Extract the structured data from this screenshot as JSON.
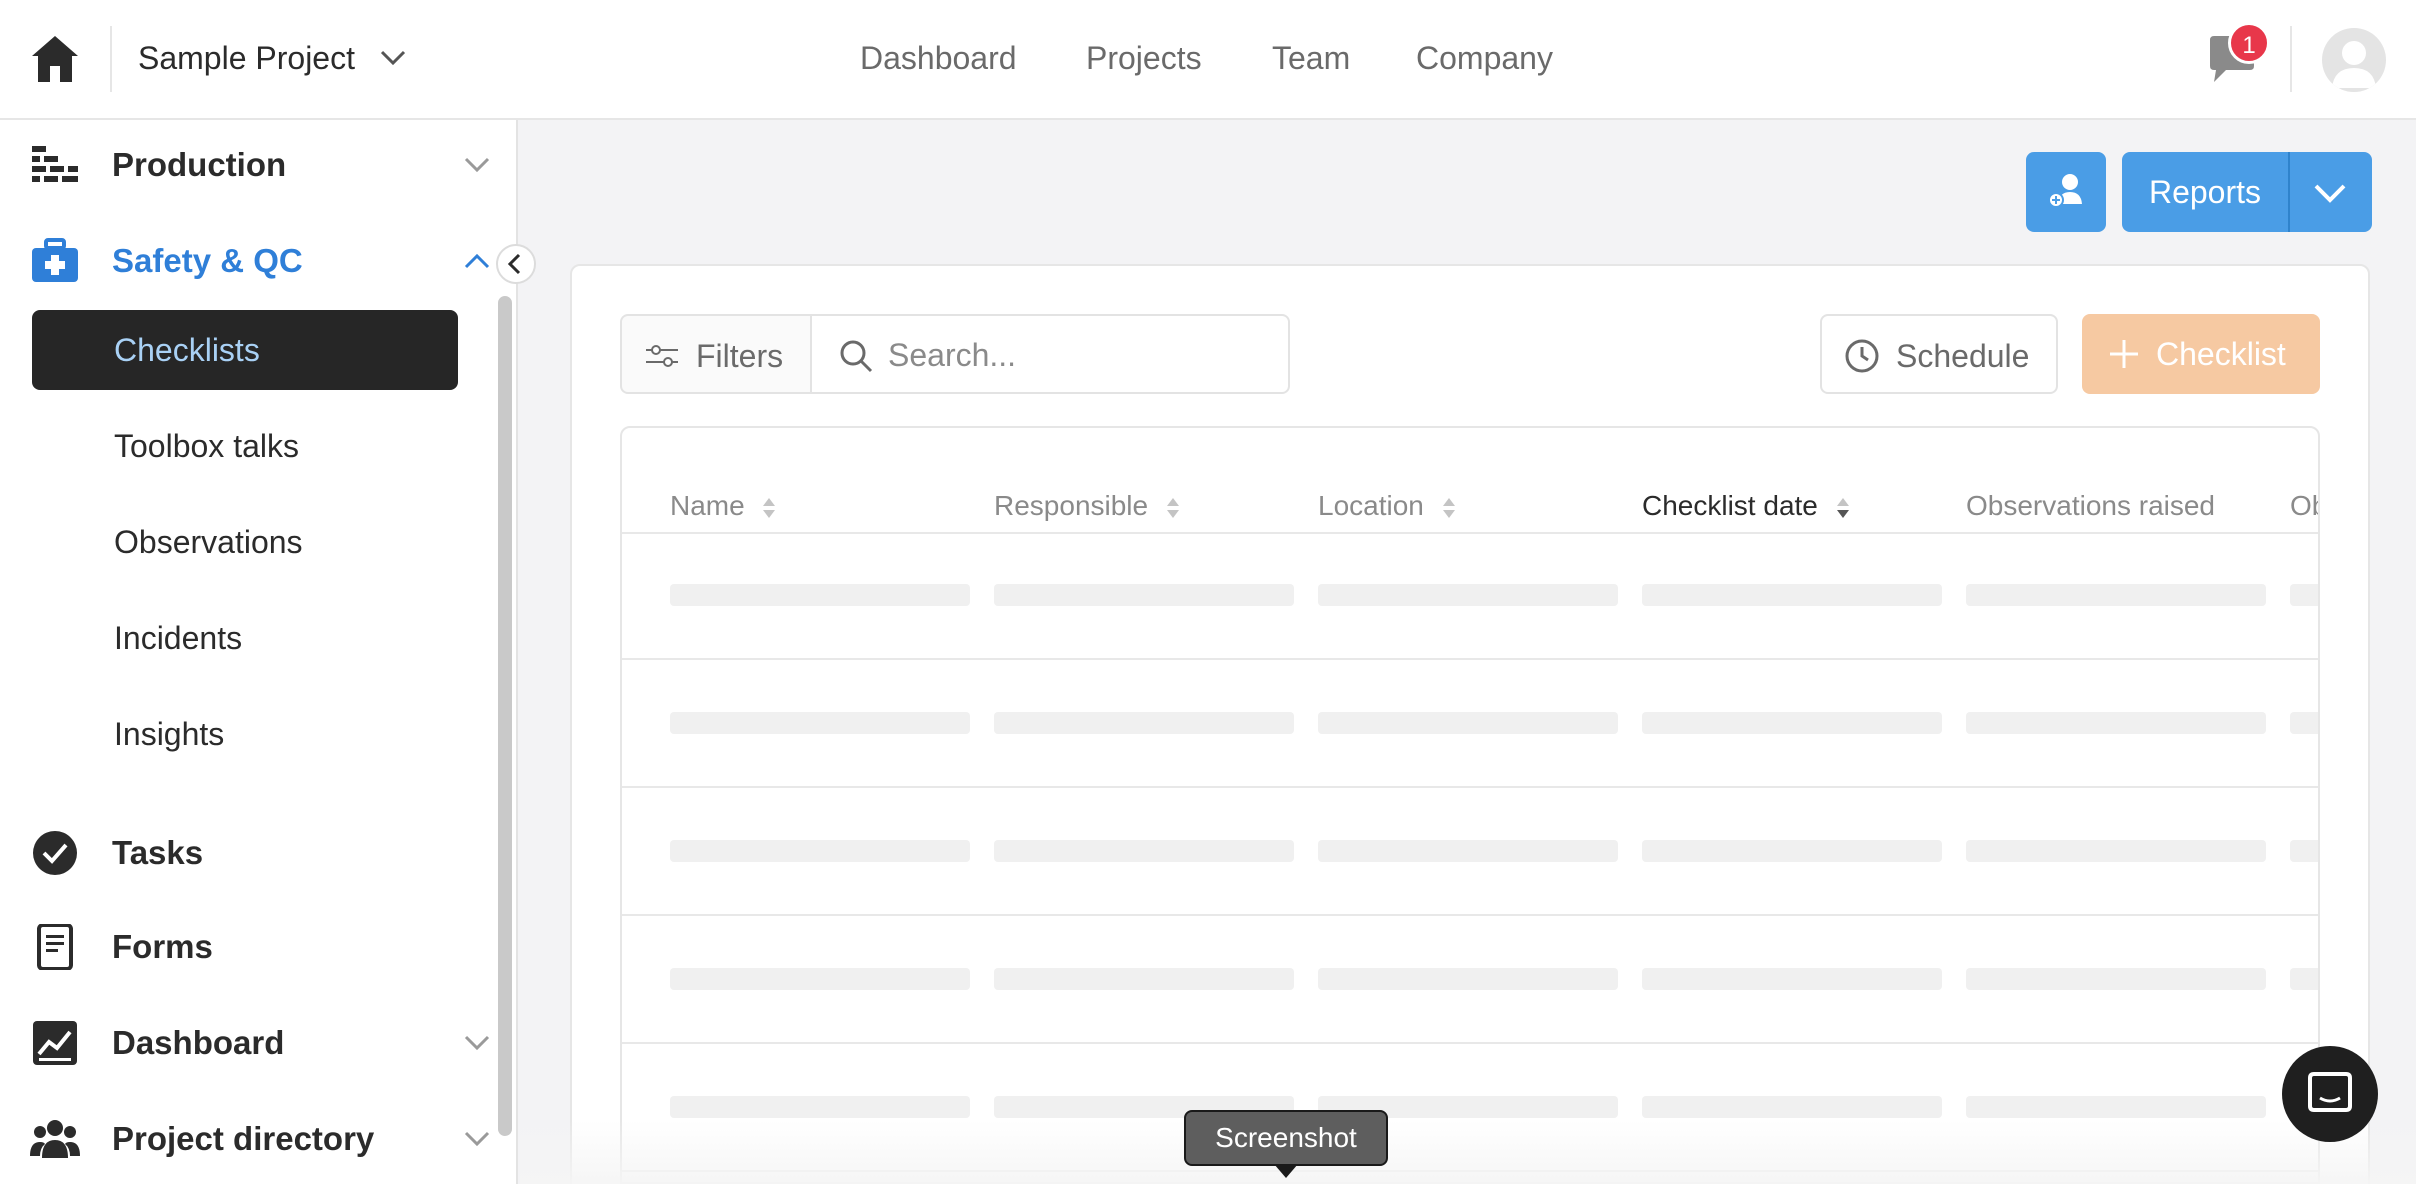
{
  "header": {
    "project_name": "Sample Project",
    "nav": [
      "Dashboard",
      "Projects",
      "Team",
      "Company"
    ],
    "notification_count": "1"
  },
  "sidebar": {
    "production": "Production",
    "safety": "Safety & QC",
    "safety_items": [
      "Checklists",
      "Toolbox talks",
      "Observations",
      "Incidents",
      "Insights"
    ],
    "active_item": "Checklists",
    "tasks": "Tasks",
    "forms": "Forms",
    "dashboard": "Dashboard",
    "project_directory": "Project directory"
  },
  "toolbar": {
    "reports_label": "Reports",
    "filters_label": "Filters",
    "search_placeholder": "Search...",
    "schedule_label": "Schedule",
    "checklist_label": "Checklist"
  },
  "table": {
    "columns": [
      "Name",
      "Responsible",
      "Location",
      "Checklist date",
      "Observations raised",
      "Ob"
    ],
    "sorted_column": "Checklist date",
    "loading_rows": 5
  },
  "tooltip": {
    "label": "Screenshot"
  },
  "colors": {
    "accent_blue": "#4a9de6",
    "active_link": "#2f7fd8",
    "checklist_orange": "#f6c9a2",
    "badge_red": "#e8374a"
  }
}
